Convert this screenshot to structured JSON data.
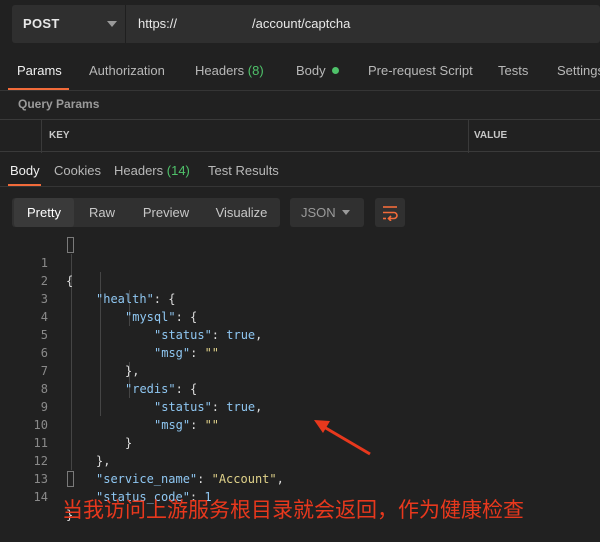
{
  "request": {
    "method": "POST",
    "url_start": "https://",
    "url_end": "/account/captcha"
  },
  "request_tabs": {
    "params": "Params",
    "authorization": "Authorization",
    "headers": "Headers",
    "headers_count": "(8)",
    "body": "Body",
    "prerequest": "Pre-request Script",
    "tests": "Tests",
    "settings": "Settings"
  },
  "query_params": {
    "title": "Query Params",
    "key_header": "KEY",
    "value_header": "VALUE"
  },
  "response_tabs": {
    "body": "Body",
    "cookies": "Cookies",
    "headers": "Headers",
    "headers_count": "(14)",
    "test_results": "Test Results"
  },
  "view": {
    "pretty": "Pretty",
    "raw": "Raw",
    "preview": "Preview",
    "visualize": "Visualize",
    "format": "JSON",
    "wrap_icon": "wrap-lines-icon"
  },
  "code_lines": {
    "l1": {
      "n": "1",
      "t": "{"
    },
    "l2": {
      "n": "2",
      "key": "\"health\"",
      "p": ": {"
    },
    "l3": {
      "n": "3",
      "key": "\"mysql\"",
      "p": ": {"
    },
    "l4": {
      "n": "4",
      "key": "\"status\"",
      "p": ": ",
      "v": "true",
      "e": ","
    },
    "l5": {
      "n": "5",
      "key": "\"msg\"",
      "p": ": ",
      "v": "\"\""
    },
    "l6": {
      "n": "6",
      "t": "},"
    },
    "l7": {
      "n": "7",
      "key": "\"redis\"",
      "p": ": {"
    },
    "l8": {
      "n": "8",
      "key": "\"status\"",
      "p": ": ",
      "v": "true",
      "e": ","
    },
    "l9": {
      "n": "9",
      "key": "\"msg\"",
      "p": ": ",
      "v": "\"\""
    },
    "l10": {
      "n": "10",
      "t": "}"
    },
    "l11": {
      "n": "11",
      "t": "},"
    },
    "l12": {
      "n": "12",
      "key": "\"service_name\"",
      "p": ": ",
      "v": "\"Account\"",
      "e": ","
    },
    "l13": {
      "n": "13",
      "key": "\"status_code\"",
      "p": ": ",
      "v": "1"
    },
    "l14": {
      "n": "14",
      "t": "}"
    }
  },
  "annotation": {
    "text": "当我访问上游服务根目录就会返回，作为健康检查",
    "color": "#e8381d"
  },
  "colors": {
    "accent": "#f26b3a",
    "count_green": "#4fc26a",
    "background": "#212121"
  }
}
